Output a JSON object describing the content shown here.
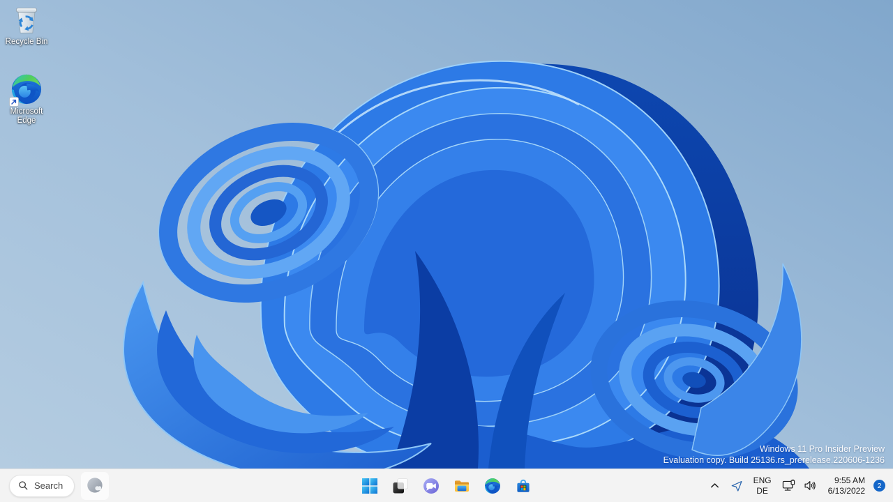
{
  "desktop": {
    "icons": [
      {
        "name": "recycle-bin",
        "label": "Recycle Bin"
      },
      {
        "name": "microsoft-edge",
        "label": "Microsoft Edge"
      }
    ],
    "watermark": {
      "line1": "Windows 11 Pro Insider Preview",
      "line2": "Evaluation copy. Build 25136.rs_prerelease.220606-1236"
    }
  },
  "taskbar": {
    "search": {
      "label": "Search",
      "icon": "search-icon"
    },
    "widgets": {
      "icon": "weather-widget-icon"
    },
    "center_icons": [
      {
        "name": "start"
      },
      {
        "name": "task-view"
      },
      {
        "name": "chat"
      },
      {
        "name": "file-explorer"
      },
      {
        "name": "edge"
      },
      {
        "name": "store"
      }
    ],
    "tray": {
      "hidden_icons_chevron": "chevron-up-icon",
      "location_icon": "location-in-use-icon",
      "language": {
        "line1": "ENG",
        "line2": "DE"
      },
      "network_icon": "ethernet-network-icon",
      "volume_icon": "speaker-icon",
      "clock": {
        "time": "9:55 AM",
        "date": "6/13/2022"
      },
      "notification_badge": "2"
    }
  },
  "colors": {
    "taskbar_bg": "#f3f3f3",
    "badge_blue": "#1466c8",
    "bloom_blue": "#2d7ae6",
    "background_sky": "#9db9d6"
  }
}
